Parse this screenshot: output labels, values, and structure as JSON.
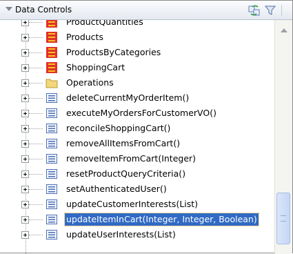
{
  "panel": {
    "title": "Data Controls",
    "icons": [
      "collapse-arrow-icon",
      "refresh-icon",
      "filter-icon"
    ]
  },
  "tree": {
    "items": [
      {
        "label": "ProductQuantities",
        "icon": "collection-icon"
      },
      {
        "label": "Products",
        "icon": "collection-icon"
      },
      {
        "label": "ProductsByCategories",
        "icon": "collection-icon"
      },
      {
        "label": "ShoppingCart",
        "icon": "collection-icon"
      },
      {
        "label": "Operations",
        "icon": "folder-icon"
      },
      {
        "label": "deleteCurrentMyOrderItem()",
        "icon": "method-icon"
      },
      {
        "label": "executeMyOrdersForCustomerVO()",
        "icon": "method-icon"
      },
      {
        "label": "reconcileShoppingCart()",
        "icon": "method-icon"
      },
      {
        "label": "removeAllItemsFromCart()",
        "icon": "method-icon"
      },
      {
        "label": "removeItemFromCart(Integer)",
        "icon": "method-icon"
      },
      {
        "label": "resetProductQueryCriteria()",
        "icon": "method-icon"
      },
      {
        "label": "setAuthenticatedUser()",
        "icon": "method-icon"
      },
      {
        "label": "updateCustomerInterests(List)",
        "icon": "method-icon"
      },
      {
        "label": "updateItemInCart(Integer, Integer, Boolean)",
        "icon": "method-icon",
        "selected": true
      },
      {
        "label": "updateUserInterests(List)",
        "icon": "method-icon"
      }
    ]
  },
  "colors": {
    "selection": "#316ac5",
    "collection_red": "#e0302a",
    "collection_yellow": "#f7c21d",
    "folder": "#f3d77a",
    "method_blue": "#4a6fb5"
  }
}
